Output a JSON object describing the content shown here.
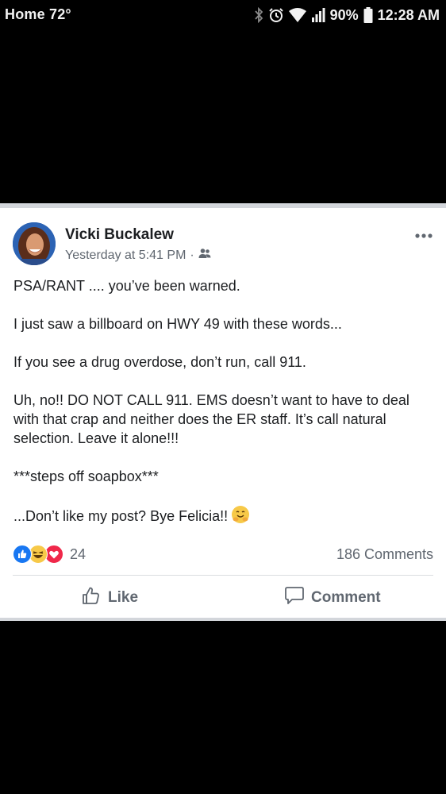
{
  "status_bar": {
    "left_text": "Home 72°",
    "battery": "90%",
    "time": "12:28 AM",
    "icons": [
      "bluetooth-icon",
      "alarm-icon",
      "wifi-icon",
      "signal-icon",
      "battery-icon"
    ]
  },
  "post": {
    "author": "Vicki Buckalew",
    "timestamp": "Yesterday at 5:41 PM",
    "meta_separator": "·",
    "audience_icon": "friends-icon",
    "paragraphs": [
      "PSA/RANT .... you’ve been warned.",
      "I just saw a billboard on HWY 49 with these words...",
      "If you see a drug overdose, don’t run, call 911.",
      "Uh, no!! DO NOT CALL 911. EMS doesn’t want to have to deal with that crap and neither does the ER staff. It’s call natural selection. Leave it alone!!!",
      "***steps off soapbox***",
      "...Don’t like my post? Bye Felicia!!"
    ],
    "closing_emoji": "hugging-face-emoji",
    "reactions": {
      "icons": [
        "like-reaction-icon",
        "haha-reaction-icon",
        "love-reaction-icon"
      ],
      "count": "24"
    },
    "comments_count": "186 Comments",
    "actions": {
      "like_label": "Like",
      "comment_label": "Comment"
    }
  },
  "colors": {
    "background": "#000000",
    "card": "#ffffff",
    "text": "#1c1e21",
    "secondary_text": "#606770",
    "like_blue": "#1877f2",
    "love_red": "#f0284a",
    "haha_yellow": "#f7c948"
  }
}
